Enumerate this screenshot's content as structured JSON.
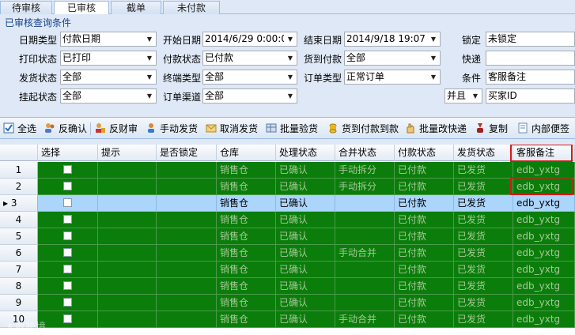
{
  "tabs": [
    {
      "label": "待审核",
      "active": false
    },
    {
      "label": "已审核",
      "active": true
    },
    {
      "label": "截单",
      "active": false
    },
    {
      "label": "未付款",
      "active": false
    }
  ],
  "filter_panel": {
    "title": "已审核查询条件",
    "fields": {
      "date_type": {
        "label": "日期类型",
        "value": "付款日期"
      },
      "start_date": {
        "label": "开始日期",
        "value": "2014/6/29 0:00:00"
      },
      "end_date": {
        "label": "结束日期",
        "value": "2014/9/18 19:07"
      },
      "locked": {
        "label": "锁定",
        "value": "未锁定"
      },
      "print_status": {
        "label": "打印状态",
        "value": "已打印"
      },
      "pay_status": {
        "label": "付款状态",
        "value": "已付款"
      },
      "cod": {
        "label": "货到付款",
        "value": "全部"
      },
      "express": {
        "label": "快递",
        "value": ""
      },
      "ship_status": {
        "label": "发货状态",
        "value": "全部"
      },
      "terminal_type": {
        "label": "终端类型",
        "value": "全部"
      },
      "order_type": {
        "label": "订单类型",
        "value": "正常订单"
      },
      "condition": {
        "label": "条件",
        "value": "客服备注"
      },
      "hold_status": {
        "label": "挂起状态",
        "value": "全部"
      },
      "order_channel": {
        "label": "订单渠道",
        "value": "全部"
      },
      "logic": {
        "value": "并且"
      },
      "buyer_id": {
        "value": "买家ID"
      }
    }
  },
  "toolbar": {
    "select_all": "全选",
    "anti_confirm": "反确认",
    "anti_finance": "反财审",
    "manual_ship": "手动发货",
    "cancel_ship": "取消发货",
    "batch_verify": "批量验货",
    "cod_to_paid": "货到付款到款",
    "batch_change_express": "批量改快递",
    "copy": "复制",
    "internal_note": "内部便签"
  },
  "grid": {
    "columns": [
      "选择",
      "提示",
      "是否锁定",
      "仓库",
      "处理状态",
      "合并状态",
      "付款状态",
      "发货状态",
      "客服备注"
    ],
    "rows": [
      {
        "no": "1",
        "warehouse": "销售仓",
        "process": "已确认",
        "merge": "手动拆分",
        "pay": "已付款",
        "ship": "已发货",
        "note": "edb_yxtg",
        "selected": false
      },
      {
        "no": "2",
        "warehouse": "销售仓",
        "process": "已确认",
        "merge": "手动拆分",
        "pay": "已付款",
        "ship": "已发货",
        "note": "edb_yxtg",
        "selected": false
      },
      {
        "no": "3",
        "warehouse": "销售仓",
        "process": "已确认",
        "merge": "",
        "pay": "已付款",
        "ship": "已发货",
        "note": "edb_yxtg",
        "selected": true
      },
      {
        "no": "4",
        "warehouse": "销售仓",
        "process": "已确认",
        "merge": "",
        "pay": "已付款",
        "ship": "已发货",
        "note": "edb_yxtg",
        "selected": false
      },
      {
        "no": "5",
        "warehouse": "销售仓",
        "process": "已确认",
        "merge": "",
        "pay": "已付款",
        "ship": "已发货",
        "note": "edb_yxtg",
        "selected": false
      },
      {
        "no": "6",
        "warehouse": "销售仓",
        "process": "已确认",
        "merge": "手动合并",
        "pay": "已付款",
        "ship": "已发货",
        "note": "edb_yxtg",
        "selected": false
      },
      {
        "no": "7",
        "warehouse": "销售仓",
        "process": "已确认",
        "merge": "",
        "pay": "已付款",
        "ship": "已发货",
        "note": "edb_yxtg",
        "selected": false
      },
      {
        "no": "8",
        "warehouse": "销售仓",
        "process": "已确认",
        "merge": "",
        "pay": "已付款",
        "ship": "已发货",
        "note": "edb_yxtg",
        "selected": false
      },
      {
        "no": "9",
        "warehouse": "销售仓",
        "process": "已确认",
        "merge": "",
        "pay": "已付款",
        "ship": "已发货",
        "note": "edb_yxtg",
        "selected": false
      },
      {
        "no": "10",
        "warehouse": "销售仓",
        "process": "已确认",
        "merge": "手动合并",
        "pay": "已付款",
        "ship": "已发货",
        "note": "edb_yxtg",
        "selected": false
      }
    ]
  },
  "watermark": "大数跨境",
  "colors": {
    "row_green": "#0b7d0b",
    "row_selected": "#acd5fb",
    "highlight": "#d81818"
  }
}
